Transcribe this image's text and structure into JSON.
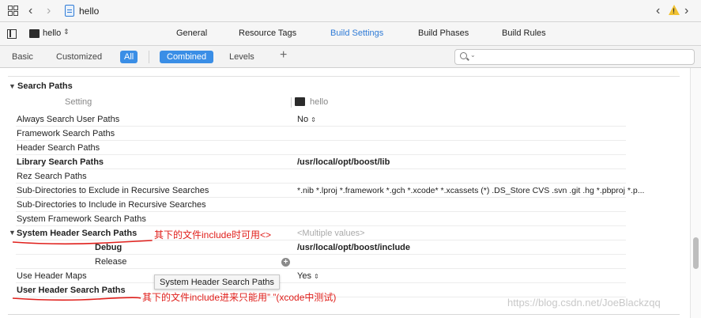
{
  "jumpbar": {
    "crumb": "hello",
    "icons": [
      "grid-icon",
      "back-icon",
      "forward-icon",
      "swift-file-icon",
      "previous-issue-icon",
      "warning-icon",
      "next-issue-icon"
    ]
  },
  "tabbar": {
    "target_name": "hello",
    "target_chevron": "⌃⌄",
    "tabs": [
      {
        "label": "General",
        "active": false
      },
      {
        "label": "Resource Tags",
        "active": false
      },
      {
        "label": "Build Settings",
        "active": true
      },
      {
        "label": "Build Phases",
        "active": false
      },
      {
        "label": "Build Rules",
        "active": false
      }
    ]
  },
  "filterbar": {
    "basic": "Basic",
    "customized": "Customized",
    "all": "All",
    "combined": "Combined",
    "levels": "Levels",
    "plus": "+",
    "search_value": ""
  },
  "section": {
    "title": "Search Paths",
    "setting_header": "Setting",
    "target_header": "hello"
  },
  "rows": [
    {
      "name": "Always Search User Paths",
      "bold": false,
      "value": "No",
      "chevron": true
    },
    {
      "name": "Framework Search Paths",
      "bold": false,
      "value": ""
    },
    {
      "name": "Header Search Paths",
      "bold": false,
      "value": ""
    },
    {
      "name": "Library Search Paths",
      "bold": true,
      "value": "/usr/local/opt/boost/lib",
      "value_bold": true
    },
    {
      "name": "Rez Search Paths",
      "bold": false,
      "value": ""
    },
    {
      "name": "Sub-Directories to Exclude in Recursive Searches",
      "bold": false,
      "value": "*.nib *.lproj *.framework *.gch *.xcode* *.xcassets (*) .DS_Store CVS .svn .git .hg *.pbproj *.p..."
    },
    {
      "name": "Sub-Directories to Include in Recursive Searches",
      "bold": false,
      "value": ""
    },
    {
      "name": "System Framework Search Paths",
      "bold": false,
      "value": ""
    },
    {
      "name": "System Header Search Paths",
      "bold": true,
      "value": "<Multiple values>",
      "value_grey": true
    },
    {
      "name": "Debug",
      "bold": true,
      "value": "/usr/local/opt/boost/include",
      "value_bold": true,
      "sub": true
    },
    {
      "name": "Release",
      "bold": false,
      "value": "",
      "sub": true
    },
    {
      "name": "Use Header Maps",
      "bold": false,
      "value": "Yes",
      "chevron": true
    },
    {
      "name": "User Header Search Paths",
      "bold": true,
      "value": ""
    }
  ],
  "tooltip": "System Header Search Paths",
  "annotations": {
    "system": "其下的文件include时可用<>",
    "user": "其下的文件include进来只能用” ”(xcode中测试)",
    "color": "#e0201c"
  },
  "watermark": "https://blog.csdn.net/JoeBlackzqq",
  "colors": {
    "accent": "#2f7bd6",
    "selected_button": "#3a8ee6",
    "warning": "#f1c232"
  }
}
